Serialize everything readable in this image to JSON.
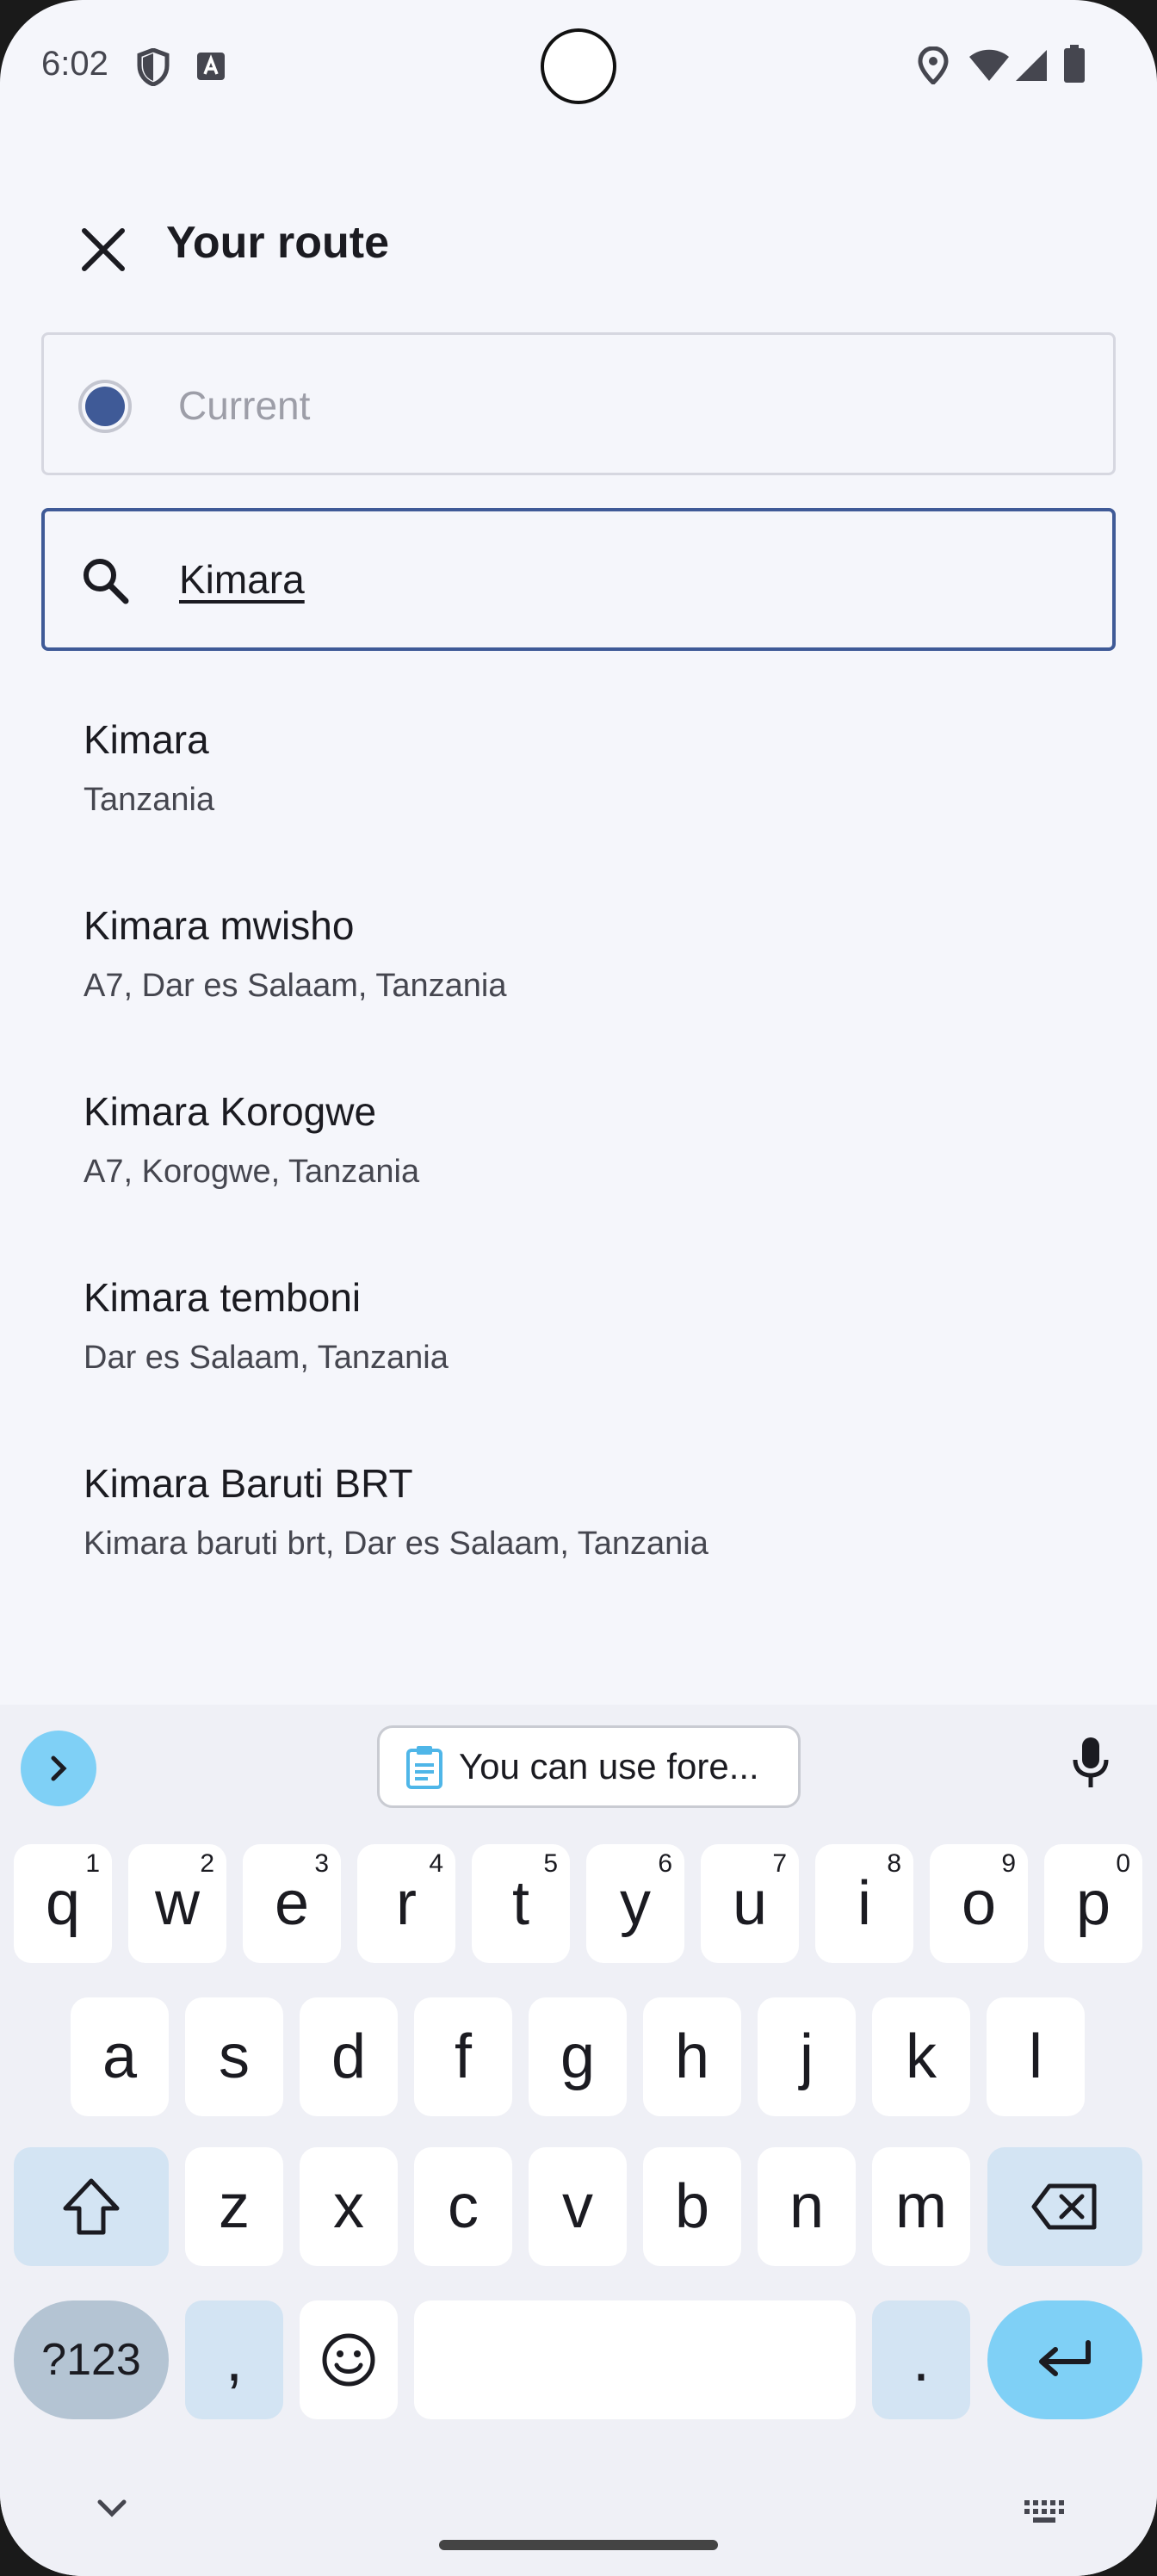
{
  "status_bar": {
    "time": "6:02"
  },
  "header": {
    "title": "Your route",
    "close_icon": "close-icon"
  },
  "origin_field": {
    "placeholder": "Current"
  },
  "search_field": {
    "value": "Kimara"
  },
  "results": [
    {
      "name": "Kimara",
      "address": "Tanzania"
    },
    {
      "name": "Kimara mwisho",
      "address": "A7, Dar es Salaam, Tanzania"
    },
    {
      "name": "Kimara Korogwe",
      "address": "A7, Korogwe, Tanzania"
    },
    {
      "name": "Kimara temboni",
      "address": "Dar es Salaam, Tanzania"
    },
    {
      "name": "Kimara Baruti BRT",
      "address": "Kimara baruti brt, Dar es Salaam, Tanzania"
    }
  ],
  "keyboard": {
    "clipboard_suggestion": "You can use fore...",
    "row1": [
      {
        "k": "q",
        "h": "1"
      },
      {
        "k": "w",
        "h": "2"
      },
      {
        "k": "e",
        "h": "3"
      },
      {
        "k": "r",
        "h": "4"
      },
      {
        "k": "t",
        "h": "5"
      },
      {
        "k": "y",
        "h": "6"
      },
      {
        "k": "u",
        "h": "7"
      },
      {
        "k": "i",
        "h": "8"
      },
      {
        "k": "o",
        "h": "9"
      },
      {
        "k": "p",
        "h": "0"
      }
    ],
    "row2": [
      "a",
      "s",
      "d",
      "f",
      "g",
      "h",
      "j",
      "k",
      "l"
    ],
    "row3": [
      "z",
      "x",
      "c",
      "v",
      "b",
      "n",
      "m"
    ],
    "symbols_label": "?123",
    "comma_label": ",",
    "period_label": "."
  },
  "colors": {
    "accent": "#3f5a97",
    "keyboard_accent": "#7fd0f6"
  }
}
